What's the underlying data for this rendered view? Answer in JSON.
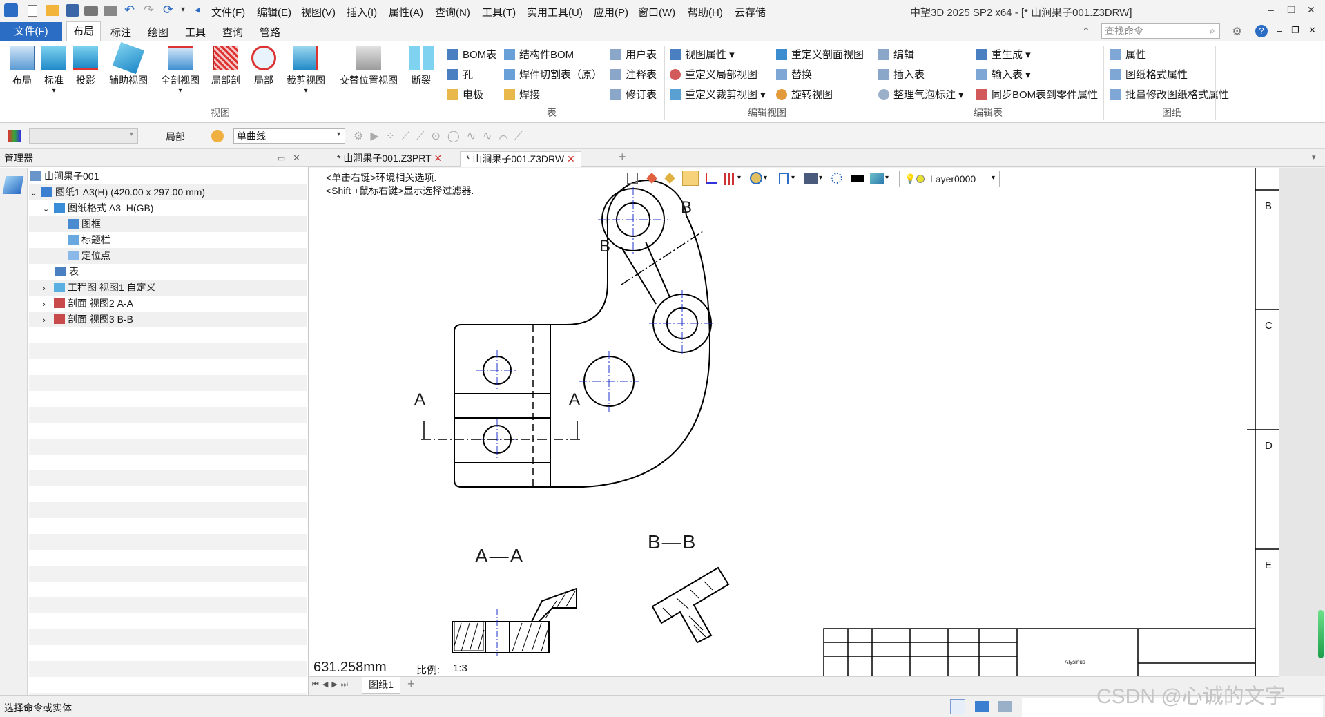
{
  "app": {
    "title": "中望3D 2025 SP2 x64 - [* 山涧果子001.Z3DRW]",
    "menus": [
      "文件(F)",
      "编辑(E)",
      "视图(V)",
      "插入(I)",
      "属性(A)",
      "查询(N)",
      "工具(T)",
      "实用工具(U)",
      "应用(P)",
      "窗口(W)",
      "帮助(H)",
      "云存储"
    ]
  },
  "ribbon_tabs": {
    "file": "文件(F)",
    "items": [
      "布局",
      "标注",
      "绘图",
      "工具",
      "查询",
      "管路"
    ],
    "search_placeholder": "查找命令"
  },
  "ribbon": {
    "view_group": {
      "label": "视图",
      "buttons": [
        "布局",
        "标准",
        "投影",
        "辅助视图",
        "全剖视图",
        "局部剖",
        "局部",
        "裁剪视图",
        "交替位置视图",
        "断裂"
      ]
    },
    "table_group": {
      "label": "表",
      "col1": [
        "BOM表",
        "孔",
        "电极"
      ],
      "col2": [
        "结构件BOM",
        "焊件切割表（原）",
        "焊接"
      ],
      "col3": [
        "用户表",
        "注释表",
        "修订表"
      ]
    },
    "edit_view_group": {
      "label": "编辑视图",
      "col1": [
        "视图属性",
        "重定义局部视图",
        "重定义裁剪视图"
      ],
      "col2": [
        "重定义剖面视图",
        "替换",
        "旋转视图"
      ]
    },
    "edit_table_group": {
      "label": "编辑表",
      "col1": [
        "编辑",
        "插入表",
        "整理气泡标注"
      ],
      "col2": [
        "重生成",
        "输入表",
        "同步BOM表到零件属性"
      ]
    },
    "sheet_group": {
      "label": "图纸",
      "col1": [
        "属性",
        "图纸格式属性",
        "批量修改图纸格式属性"
      ]
    }
  },
  "toolbar2": {
    "filter_label": "局部",
    "curve_select": "单曲线"
  },
  "manager": {
    "title": "管理器",
    "tree": [
      {
        "label": "山涧果子001",
        "indent": 0
      },
      {
        "label": "图纸1 A3(H) (420.00 x 297.00 mm)",
        "indent": 1
      },
      {
        "label": "图纸格式 A3_H(GB)",
        "indent": 2
      },
      {
        "label": "图框",
        "indent": 3
      },
      {
        "label": "标题栏",
        "indent": 3
      },
      {
        "label": "定位点",
        "indent": 3
      },
      {
        "label": "表",
        "indent": 2
      },
      {
        "label": "工程图 视图1 自定义",
        "indent": 2
      },
      {
        "label": "剖面 视图2 A-A",
        "indent": 2
      },
      {
        "label": "剖面 视图3 B-B",
        "indent": 2
      }
    ]
  },
  "doc_tabs": [
    "* 山涧果子001.Z3PRT",
    "* 山涧果子001.Z3DRW"
  ],
  "canvas": {
    "hint1": "<单击右键>环境相关选项.",
    "hint2": "<Shift +鼠标右键>显示选择过滤器.",
    "layer": "Layer0000",
    "section_a": "A",
    "section_b": "B",
    "label_aa": "A—A",
    "label_bb": "B—B",
    "title_block_text": "Alysinus",
    "measure": "631.258mm",
    "scale_label": "比例:",
    "scale_value": "1:3",
    "border_letters": [
      "B",
      "C",
      "D",
      "E"
    ]
  },
  "sheet_tab": "图纸1",
  "status": {
    "text": "选择命令或实体",
    "watermark": "CSDN @心诚的文字"
  }
}
